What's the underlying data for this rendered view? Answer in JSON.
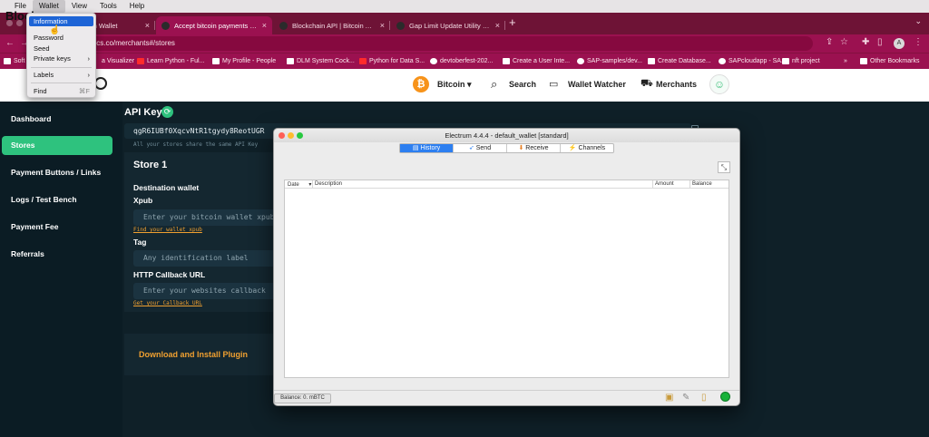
{
  "menubar": {
    "apple": "",
    "items": [
      "File",
      "Wallet",
      "View",
      "Tools",
      "Help"
    ]
  },
  "wallet_menu": {
    "items": [
      "Information",
      "Password",
      "Seed",
      "Private keys",
      "Labels",
      "Find"
    ],
    "shortcut_find": "⌘F",
    "arrow": "›"
  },
  "tabs": [
    {
      "title": "in Wallet",
      "color": "#2b2b2b"
    },
    {
      "title": "Accept bitcoin payments - Block",
      "color": "#2b2b2b"
    },
    {
      "title": "Blockchain API | Bitcoin API - B",
      "color": "#2b2b2b"
    },
    {
      "title": "Gap Limit Update Utility - Block",
      "color": "#2b2b2b"
    }
  ],
  "tab_close": "×",
  "new_tab": "+",
  "address": "nics.co/merchants#/stores",
  "profile_letter": "A",
  "bookmarks": [
    {
      "label": "Soft",
      "color": "#ffffff"
    },
    {
      "label": "a Visualizer",
      "color": "#ffffff"
    },
    {
      "label": "Learn Python - Ful...",
      "color": "#ff2b2b"
    },
    {
      "label": "My Profile - People",
      "color": "#ffffff"
    },
    {
      "label": "DLM System Cock...",
      "color": "#ffffff"
    },
    {
      "label": "Python for Data S...",
      "color": "#ff2b2b"
    },
    {
      "label": "devtoberfest-202...",
      "color": "#ffffff"
    },
    {
      "label": "Create a User Inte...",
      "color": "#ffffff"
    },
    {
      "label": "SAP-samples/dev...",
      "color": "#ffffff"
    },
    {
      "label": "Create Database...",
      "color": "#ffffff"
    },
    {
      "label": "SAPcloudapp - SA...",
      "color": "#ffffff"
    },
    {
      "label": "nft project",
      "color": "#ffffff"
    },
    {
      "label": "Other Bookmarks",
      "color": "#ffffff"
    }
  ],
  "bookmarks_more": "»",
  "site": {
    "logo": "Blockc",
    "coin_symbol": "₿",
    "coin": "Bitcoin",
    "caret": "▾",
    "search": "Search",
    "wallet_watcher": "Wallet Watcher",
    "merchants": "Merchants"
  },
  "sidebar": [
    {
      "label": "Dashboard",
      "active": false
    },
    {
      "label": "Stores",
      "active": true
    },
    {
      "label": "Payment Buttons / Links",
      "active": false
    },
    {
      "label": "Logs / Test Bench",
      "active": false
    },
    {
      "label": "Payment Fee",
      "active": false
    },
    {
      "label": "Referrals",
      "active": false
    }
  ],
  "main": {
    "api_key_title": "API Key",
    "api_key_value": "qgR6IUBf0XqcvNtR1tgydy8ReotUGR",
    "api_hint": "All your stores share the same API Key",
    "store_title": "Store 1",
    "destination_wallet": "Destination wallet",
    "xpub_label": "Xpub",
    "xpub_placeholder": "Enter your bitcoin wallet xpub",
    "xpub_link": "Find your wallet xpub",
    "tag_label": "Tag",
    "tag_placeholder": "Any identification label",
    "callback_label": "HTTP Callback URL",
    "callback_placeholder": "Enter your websites callback",
    "callback_link": "Get your Callback URL",
    "plugin_link": "Download and Install Plugin"
  },
  "electrum": {
    "title": "Electrum 4.4.4  -  default_wallet  [standard]",
    "tabs": [
      "History",
      "Send",
      "Receive",
      "Channels"
    ],
    "columns": [
      "Date",
      "Description",
      "Amount",
      "Balance"
    ],
    "sort_arrow": "▾",
    "balance": "Balance: 0. mBTC",
    "colors": {
      "traffic_red": "#fe5f57",
      "traffic_yellow": "#febc2e",
      "traffic_green": "#28c840",
      "status_green": "#18b23a"
    }
  },
  "colors": {
    "brand_green": "#2ec27e",
    "link_orange": "#f0a030",
    "bitcoin_orange": "#f7931a",
    "chrome_tab": "#9b1150"
  }
}
